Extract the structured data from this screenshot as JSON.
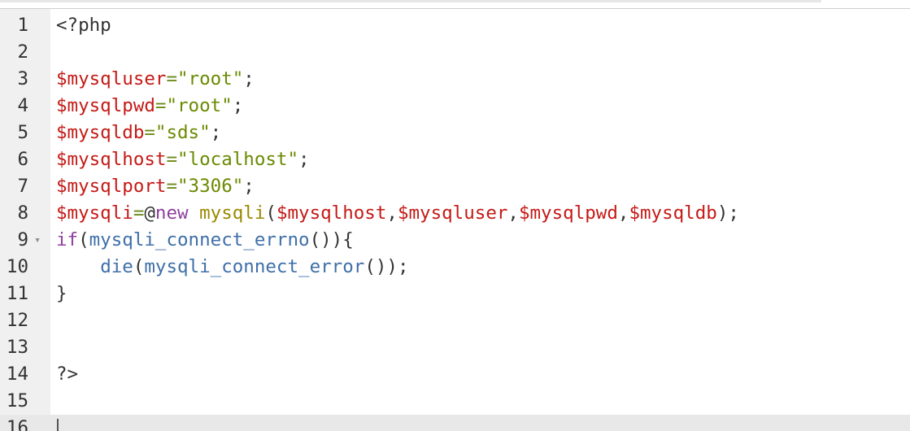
{
  "editor": {
    "lines": [
      {
        "number": "1",
        "tokens": [
          {
            "text": "<?php",
            "type": "plain"
          }
        ]
      },
      {
        "number": "2",
        "tokens": []
      },
      {
        "number": "3",
        "tokens": [
          {
            "text": "$mysqluser",
            "type": "var"
          },
          {
            "text": "=",
            "type": "op"
          },
          {
            "text": "\"root\"",
            "type": "str"
          },
          {
            "text": ";",
            "type": "punct"
          }
        ]
      },
      {
        "number": "4",
        "tokens": [
          {
            "text": "$mysqlpwd",
            "type": "var"
          },
          {
            "text": "=",
            "type": "op"
          },
          {
            "text": "\"root\"",
            "type": "str"
          },
          {
            "text": ";",
            "type": "punct"
          }
        ]
      },
      {
        "number": "5",
        "tokens": [
          {
            "text": "$mysqldb",
            "type": "var"
          },
          {
            "text": "=",
            "type": "op"
          },
          {
            "text": "\"sds\"",
            "type": "str"
          },
          {
            "text": ";",
            "type": "punct"
          }
        ]
      },
      {
        "number": "6",
        "tokens": [
          {
            "text": "$mysqlhost",
            "type": "var"
          },
          {
            "text": "=",
            "type": "op"
          },
          {
            "text": "\"localhost\"",
            "type": "str"
          },
          {
            "text": ";",
            "type": "punct"
          }
        ]
      },
      {
        "number": "7",
        "tokens": [
          {
            "text": "$mysqlport",
            "type": "var"
          },
          {
            "text": "=",
            "type": "op"
          },
          {
            "text": "\"3306\"",
            "type": "str"
          },
          {
            "text": ";",
            "type": "punct"
          }
        ]
      },
      {
        "number": "8",
        "tokens": [
          {
            "text": "$mysqli",
            "type": "var"
          },
          {
            "text": "=",
            "type": "op"
          },
          {
            "text": "@",
            "type": "punct"
          },
          {
            "text": "new",
            "type": "kw"
          },
          {
            "text": " ",
            "type": "plain"
          },
          {
            "text": "mysqli",
            "type": "class"
          },
          {
            "text": "(",
            "type": "punct"
          },
          {
            "text": "$mysqlhost",
            "type": "var"
          },
          {
            "text": ",",
            "type": "punct"
          },
          {
            "text": "$mysqluser",
            "type": "var"
          },
          {
            "text": ",",
            "type": "punct"
          },
          {
            "text": "$mysqlpwd",
            "type": "var"
          },
          {
            "text": ",",
            "type": "punct"
          },
          {
            "text": "$mysqldb",
            "type": "var"
          },
          {
            "text": ");",
            "type": "punct"
          }
        ]
      },
      {
        "number": "9",
        "fold": true,
        "tokens": [
          {
            "text": "if",
            "type": "kw"
          },
          {
            "text": "(",
            "type": "punct"
          },
          {
            "text": "mysqli_connect_errno",
            "type": "fn"
          },
          {
            "text": "()){",
            "type": "punct"
          }
        ]
      },
      {
        "number": "10",
        "tokens": [
          {
            "text": "    ",
            "type": "plain"
          },
          {
            "text": "die",
            "type": "fn"
          },
          {
            "text": "(",
            "type": "punct"
          },
          {
            "text": "mysqli_connect_error",
            "type": "fn"
          },
          {
            "text": "());",
            "type": "punct"
          }
        ]
      },
      {
        "number": "11",
        "tokens": [
          {
            "text": "}",
            "type": "punct"
          }
        ]
      },
      {
        "number": "12",
        "tokens": []
      },
      {
        "number": "13",
        "tokens": []
      },
      {
        "number": "14",
        "tokens": [
          {
            "text": "?>",
            "type": "plain"
          }
        ]
      },
      {
        "number": "15",
        "tokens": []
      },
      {
        "number": "16",
        "active": true,
        "tokens": []
      }
    ],
    "fold_icon": "fold-arrow-down-icon",
    "fold_glyph": "▾",
    "colors": {
      "gutter_bg": "#f0f0f0",
      "active_line_bg": "#e8e8e8",
      "variable": "#c41a16",
      "string": "#6a8a00",
      "keyword": "#8f3f9f",
      "function": "#3f6fa8",
      "class": "#9a8a00"
    }
  }
}
